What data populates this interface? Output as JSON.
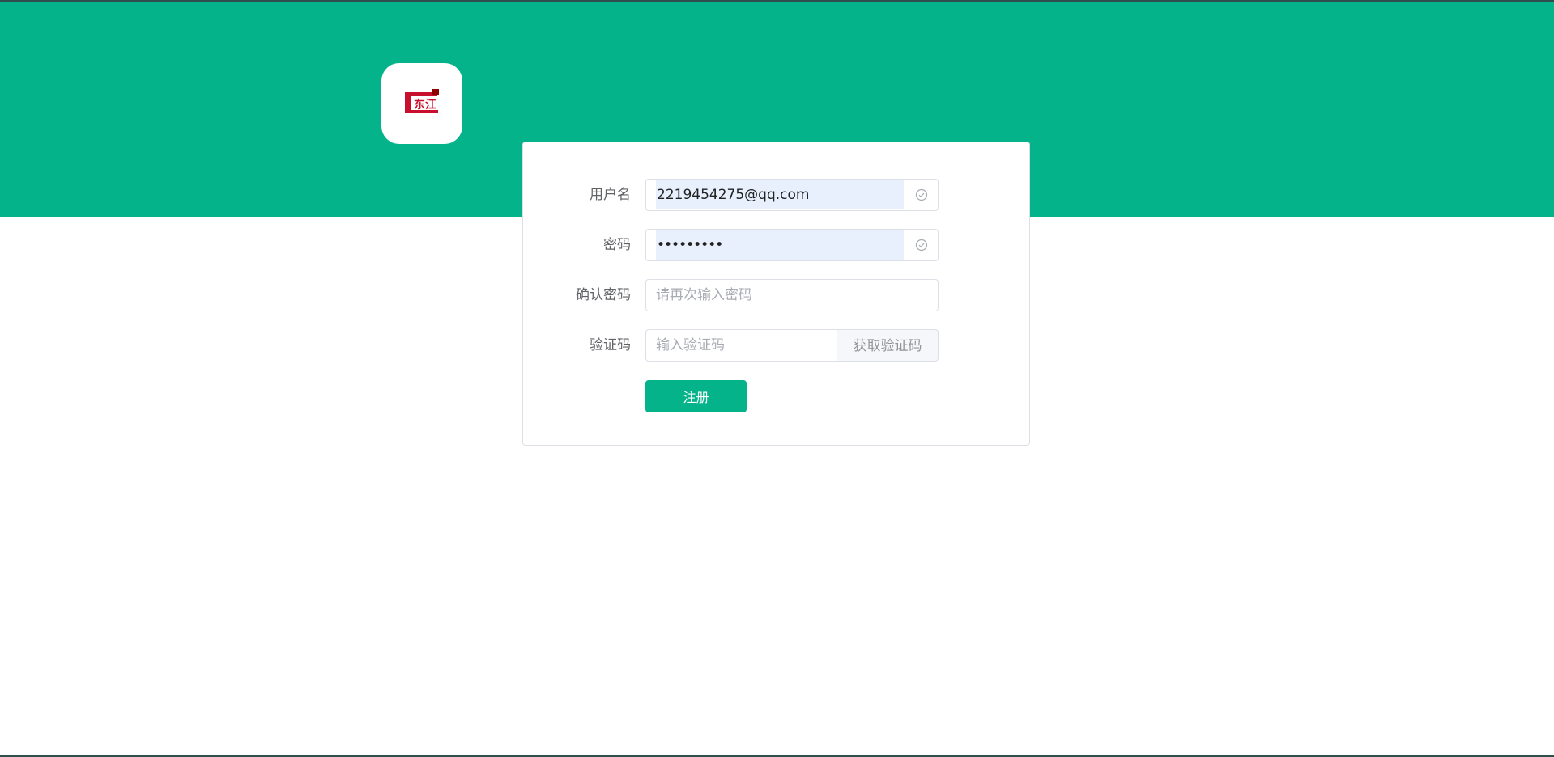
{
  "logo": {
    "brand_text": "东江",
    "accent_color": "#c8102e"
  },
  "colors": {
    "primary": "#05b38a",
    "autofill_bg": "#e8f0fe",
    "border": "#dcdfe6",
    "label": "#606266",
    "placeholder": "#a8abb2"
  },
  "form": {
    "username": {
      "label": "用户名",
      "value": "2219454275@qq.com",
      "icon": "circle-check-icon"
    },
    "password": {
      "label": "密码",
      "value": "•••••••••",
      "icon": "circle-check-icon"
    },
    "confirm_password": {
      "label": "确认密码",
      "placeholder": "请再次输入密码"
    },
    "captcha": {
      "label": "验证码",
      "placeholder": "输入验证码",
      "get_code_label": "获取验证码"
    },
    "submit_label": "注册"
  }
}
